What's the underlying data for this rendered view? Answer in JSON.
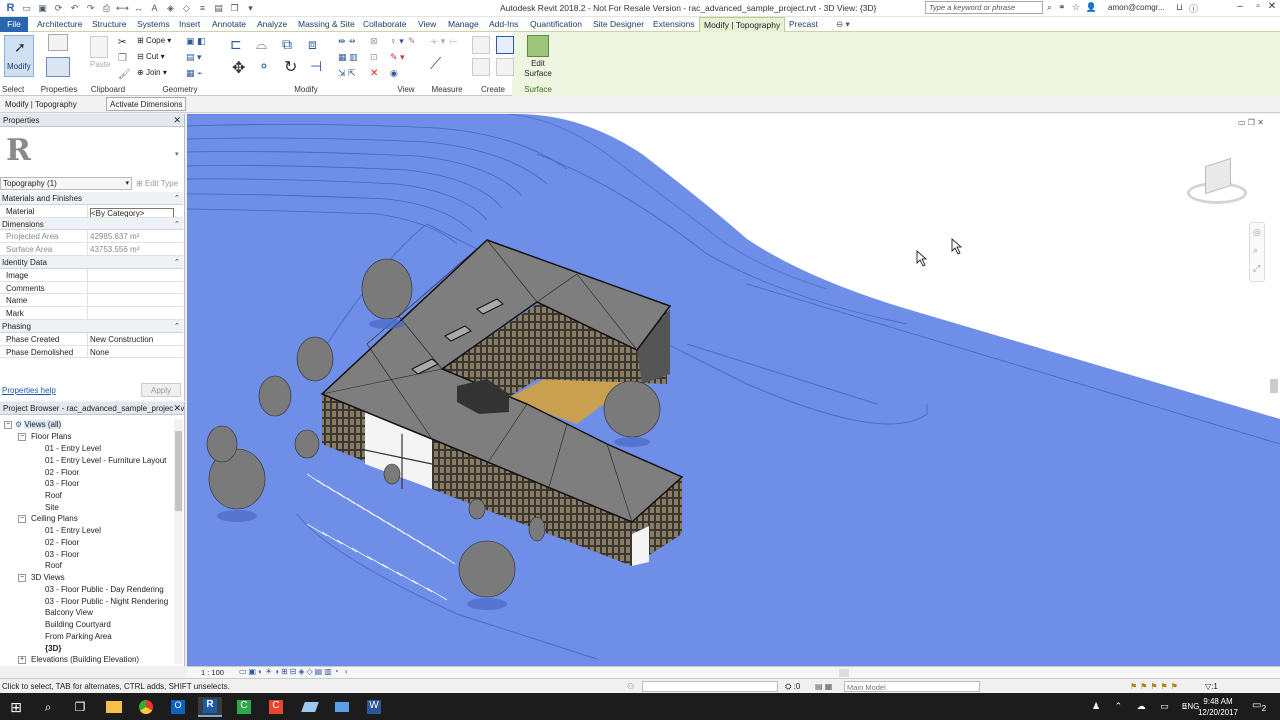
{
  "window": {
    "title": "Autodesk Revit 2018.2 - Not For Resale Version -    rac_advanced_sample_project.rvt - 3D View: {3D}",
    "search_placeholder": "Type a keyword or phrase",
    "user": "amon@comgr..."
  },
  "tabs": [
    "File",
    "Architecture",
    "Structure",
    "Systems",
    "Insert",
    "Annotate",
    "Analyze",
    "Massing & Site",
    "Collaborate",
    "View",
    "Manage",
    "Add-Ins",
    "Quantification",
    "Site Designer",
    "Extensions",
    "Modify | Topography",
    "Precast"
  ],
  "active_tab": "Modify | Topography",
  "ribbon": {
    "modify_label": "Modify",
    "paste_label": "Paste",
    "cope_label": "Cope",
    "cut_label": "Cut",
    "join_label": "Join",
    "edit_surface_label": "Edit Surface",
    "panels": [
      "Select",
      "Properties",
      "Clipboard",
      "Geometry",
      "Modify",
      "View",
      "Measure",
      "Create",
      "Surface"
    ]
  },
  "options_bar": {
    "context": "Modify | Topography",
    "button": "Activate Dimensions"
  },
  "properties": {
    "title": "Properties",
    "type_selector": "Topography (1)",
    "edit_type": "Edit Type",
    "rows": [
      {
        "group": "Materials and Finishes"
      },
      {
        "key": "Material",
        "value": "<By Category>"
      },
      {
        "group": "Dimensions"
      },
      {
        "key": "Projected Area",
        "value": "42985.637 m²"
      },
      {
        "key": "Surface Area",
        "value": "43753.556 m²"
      },
      {
        "group": "Identity Data"
      },
      {
        "key": "Image",
        "value": ""
      },
      {
        "key": "Comments",
        "value": ""
      },
      {
        "key": "Name",
        "value": ""
      },
      {
        "key": "Mark",
        "value": ""
      },
      {
        "group": "Phasing"
      },
      {
        "key": "Phase Created",
        "value": "New Construction"
      },
      {
        "key": "Phase Demolished",
        "value": "None"
      }
    ],
    "help_link": "Properties help",
    "apply": "Apply"
  },
  "project_browser": {
    "title": "Project Browser - rac_advanced_sample_project.rvt",
    "root": "Views (all)",
    "floor_plans": "Floor Plans",
    "floor_plan_items": [
      "01 - Entry Level",
      "01 - Entry Level - Furniture Layout",
      "02 - Floor",
      "03 - Floor",
      "Roof",
      "Site"
    ],
    "ceiling_plans": "Ceiling Plans",
    "ceiling_plan_items": [
      "01 - Entry Level",
      "02 - Floor",
      "03 - Floor",
      "Roof"
    ],
    "views_3d": "3D Views",
    "view_3d_items": [
      "03 - Floor Public - Day Rendering",
      "03 - Floor Public - Night Rendering",
      "Balcony View",
      "Building Courtyard",
      "From Parking Area",
      "{3D}"
    ],
    "elevations": "Elevations (Building Elevation)"
  },
  "view_bar": {
    "scale": "1 : 100"
  },
  "status_bar": {
    "message": "Click to select, TAB for alternates, CTRL adds, SHIFT unselects.",
    "counter": ":0",
    "model": "Main Model",
    "filter_count": ":1"
  },
  "taskbar": {
    "lang": "ENG",
    "time": "9:48 AM",
    "date": "12/20/2017",
    "notifications": "2"
  },
  "colors": {
    "topo_blue": "#6f8ee8",
    "ribbon_context": "#eef5e0",
    "file_tab": "#2a66b0"
  }
}
